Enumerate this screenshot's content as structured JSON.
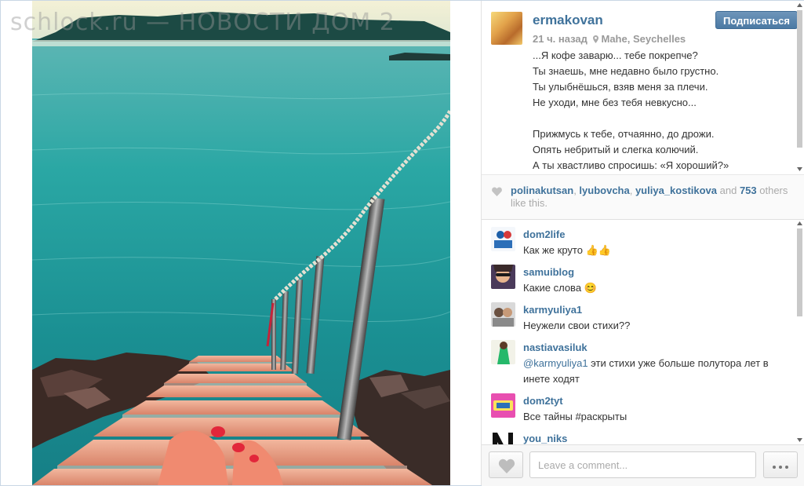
{
  "watermark": "schlock.ru — НОВОСТИ ДОМ 2",
  "post": {
    "username": "ermakovan",
    "time": "21 ч. назад",
    "location": "Mahe, Seychelles",
    "follow_label": "Подписаться",
    "caption_lines": [
      "...Я кофе заварю... тебе покрепче?",
      "Ты знаешь, мне недавно было грустно.",
      "Ты улыбнёшься, взяв меня за плечи.",
      "Не уходи, мне без тебя невкусно...",
      "",
      "Прижмусь к тебе, отчаянно, до дрожи.",
      "Опять небритый и слегка колючий.",
      "А ты хвастливо спросишь: «Я хороший?»"
    ]
  },
  "likes": {
    "users": [
      "polinakutsan",
      "lyubovcha",
      "yuliya_kostikova"
    ],
    "sep": ", ",
    "and": " and ",
    "count": "753",
    "suffix": " others like this."
  },
  "comments": [
    {
      "user": "dom2life",
      "text": "Как же круто 👍👍",
      "mention": ""
    },
    {
      "user": "samuiblog",
      "text": "Какие слова 😊",
      "mention": ""
    },
    {
      "user": "karmyuliya1",
      "text": "Неужели свои стихи??",
      "mention": ""
    },
    {
      "user": "nastiavasiluk",
      "mention": "@karmyuliya1",
      "text": " эти стихи уже больше полутора лет в инете ходят"
    },
    {
      "user": "dom2tyt",
      "text": "Все тайны #раскрыты",
      "mention": ""
    },
    {
      "user": "you_niks",
      "text": "",
      "mention": ""
    }
  ],
  "footer": {
    "comment_placeholder": "Leave a comment..."
  },
  "icons": {
    "location": "location-pin-icon",
    "heart": "heart-icon",
    "more": "ellipsis-icon"
  },
  "colors": {
    "link": "#3f729b",
    "follow_button": "#4b79a3",
    "muted": "#999999"
  }
}
